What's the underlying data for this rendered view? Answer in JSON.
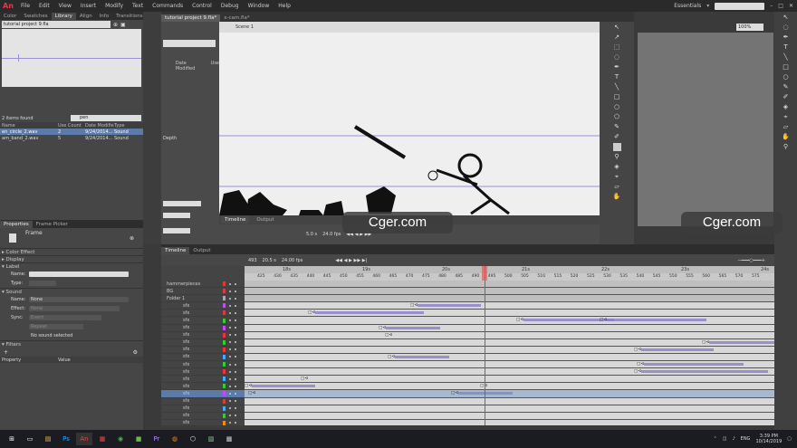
{
  "app": {
    "logo": "An",
    "menu": [
      "File",
      "Edit",
      "View",
      "Insert",
      "Modify",
      "Text",
      "Commands",
      "Control",
      "Debug",
      "Window",
      "Help"
    ],
    "workspace": "Essentials"
  },
  "left_panel": {
    "tabs": [
      "Color",
      "Swatches",
      "Library",
      "Align",
      "Info",
      "Transitions"
    ],
    "doc_select": "tutorial project 9.fla",
    "items_found": "2 items found",
    "search_value": "pen",
    "columns": [
      "Name",
      "Use Count",
      "Date Modified",
      "Type"
    ],
    "rows": [
      {
        "name": "en_circle_2.wav",
        "count": "2",
        "date": "9/24/2014...",
        "type": "Sound"
      },
      {
        "name": "am_band_2.wav",
        "count": "5",
        "date": "9/24/2014...",
        "type": "Sound"
      }
    ]
  },
  "properties": {
    "tabs": [
      "Properties",
      "Frame Picker"
    ],
    "frame_label": "Frame",
    "sections": {
      "color_effect": "Color Effect",
      "display": "Display",
      "label": "Label",
      "sound": "Sound",
      "filters": "Filters"
    },
    "label_name": "Name:",
    "label_type": "Type:",
    "sound_name_label": "Name:",
    "sound_name_value": "None",
    "effect_label": "Effect:",
    "effect_value": "None",
    "sync_label": "Sync:",
    "sync_value": "Event",
    "repeat_value": "Repeat",
    "no_sound": "No sound selected",
    "filter_cols": [
      "Property",
      "Value"
    ]
  },
  "doc_tabs": [
    "tutorial project 9.fla*",
    "x-cam.fla*"
  ],
  "scene": "Scene 1",
  "zoom": "100%",
  "inner_panel": {
    "col_date": "Date Modified",
    "col_use": "Use",
    "depth_label": "Depth"
  },
  "inner_timeline": {
    "tabs": [
      "Timeline",
      "Output"
    ],
    "fps": "5.0 s",
    "frame": "24.0 fps"
  },
  "timeline": {
    "tabs": [
      "Timeline",
      "Output"
    ],
    "frame_num": "493",
    "time": "20.5 s",
    "fps": "24.00 fps",
    "seconds": [
      "18s",
      "19s",
      "20s",
      "21s",
      "22s",
      "23s",
      "24s"
    ],
    "frames": [
      "425",
      "430",
      "435",
      "440",
      "445",
      "450",
      "455",
      "460",
      "465",
      "470",
      "475",
      "480",
      "485",
      "490",
      "495",
      "500",
      "505",
      "510",
      "515",
      "520",
      "525",
      "530",
      "535",
      "540",
      "545",
      "550",
      "555",
      "560",
      "565",
      "570",
      "575"
    ],
    "layers": [
      {
        "name": "hammerpieces",
        "color": "#e33"
      },
      {
        "name": "BG",
        "color": "#e33"
      },
      {
        "name": "Folder 1",
        "color": "#aaa"
      },
      {
        "name": "sfx",
        "color": "#c4f"
      },
      {
        "name": "sfx",
        "color": "#e33"
      },
      {
        "name": "sfx",
        "color": "#3c3"
      },
      {
        "name": "sfx",
        "color": "#c4f"
      },
      {
        "name": "sfx",
        "color": "#e33"
      },
      {
        "name": "sfx",
        "color": "#3c3"
      },
      {
        "name": "sfx",
        "color": "#e33"
      },
      {
        "name": "sfx",
        "color": "#4af"
      },
      {
        "name": "sfx",
        "color": "#3c3"
      },
      {
        "name": "sfx",
        "color": "#e33"
      },
      {
        "name": "sfx",
        "color": "#4af"
      },
      {
        "name": "sfx",
        "color": "#3c3"
      },
      {
        "name": "sfx",
        "color": "#c4f"
      },
      {
        "name": "sfx",
        "color": "#e33"
      },
      {
        "name": "sfx",
        "color": "#4af"
      },
      {
        "name": "sfx",
        "color": "#3c3"
      },
      {
        "name": "sfx",
        "color": "#f80"
      }
    ]
  },
  "watermark": "Cger.com",
  "taskbar": {
    "tray_lang": "ENG",
    "time": "3:39 PM",
    "date": "10/14/2019"
  }
}
